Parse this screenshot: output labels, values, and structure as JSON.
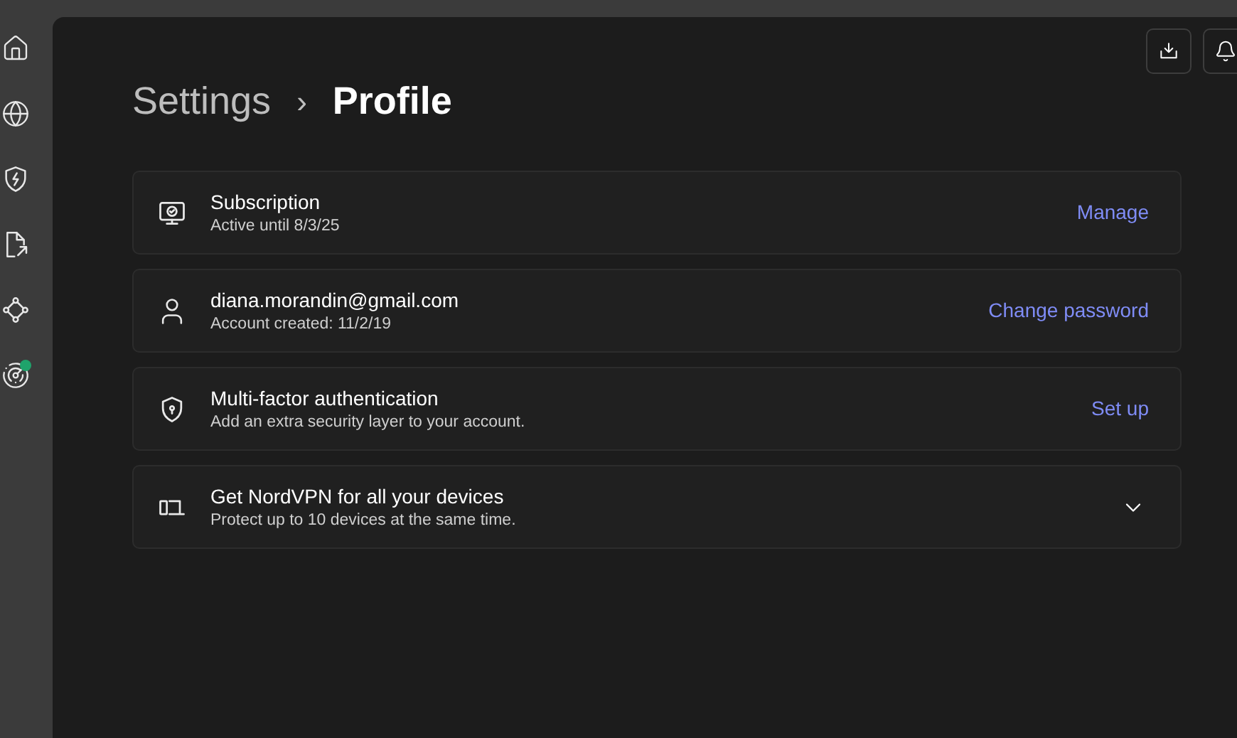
{
  "sidebar": {
    "items": [
      {
        "kind": "home"
      },
      {
        "kind": "globe"
      },
      {
        "kind": "shield"
      },
      {
        "kind": "export"
      },
      {
        "kind": "nodes"
      },
      {
        "kind": "radar",
        "color": "#1fa36b"
      }
    ]
  },
  "breadcrumb": {
    "parent": "Settings",
    "separator": "›",
    "current": "Profile"
  },
  "cards": [
    {
      "kind": "link",
      "title": "Subscription",
      "subtitle": "Active until 8/3/25",
      "action": "Manage"
    },
    {
      "kind": "link",
      "title": "diana.morandin@gmail.com",
      "subtitle": "Account created: 11/2/19",
      "action": "Change password"
    },
    {
      "kind": "link",
      "title": "Multi-factor authentication",
      "subtitle": "Add an extra security layer to your account.",
      "action": "Set up"
    },
    {
      "kind": "expand",
      "title": "Get NordVPN for all your devices",
      "subtitle": "Protect up to 10 devices at the same time.",
      "expanded": false
    }
  ]
}
